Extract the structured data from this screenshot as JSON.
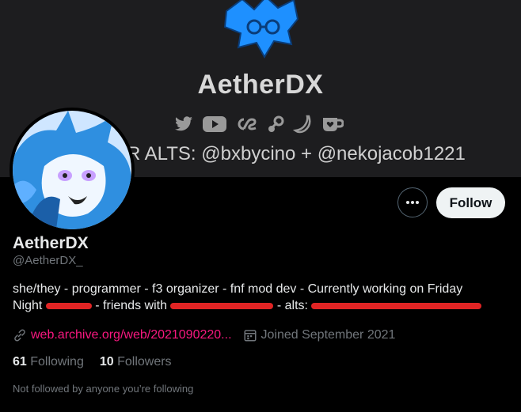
{
  "banner": {
    "title": "AetherDX",
    "subtitle": "R ALTS: @bxbycino + @nekojacob1221",
    "icons": [
      "twitter-icon",
      "youtube-icon",
      "lastfm-icon",
      "steam-icon",
      "banana-icon",
      "kofi-icon"
    ]
  },
  "profile": {
    "display_name": "AetherDX",
    "handle": "@AetherDX_",
    "bio": {
      "part1": "she/they - programmer - f3 organizer - fnf mod dev - Currently working on Friday",
      "part2": "Night",
      "part3": "- friends with",
      "part4": "- alts:"
    },
    "link": "web.archive.org/web/2021090220...",
    "joined": "Joined September 2021",
    "following_count": "61",
    "following_label": "Following",
    "followers_count": "10",
    "followers_label": "Followers",
    "mutuals_note": "Not followed by anyone you’re following"
  },
  "actions": {
    "follow_label": "Follow"
  },
  "colors": {
    "accent_link": "#f91880",
    "redaction": "#e02424",
    "banner_bg": "#1d1d1f",
    "logo_blue": "#1e90ff"
  }
}
